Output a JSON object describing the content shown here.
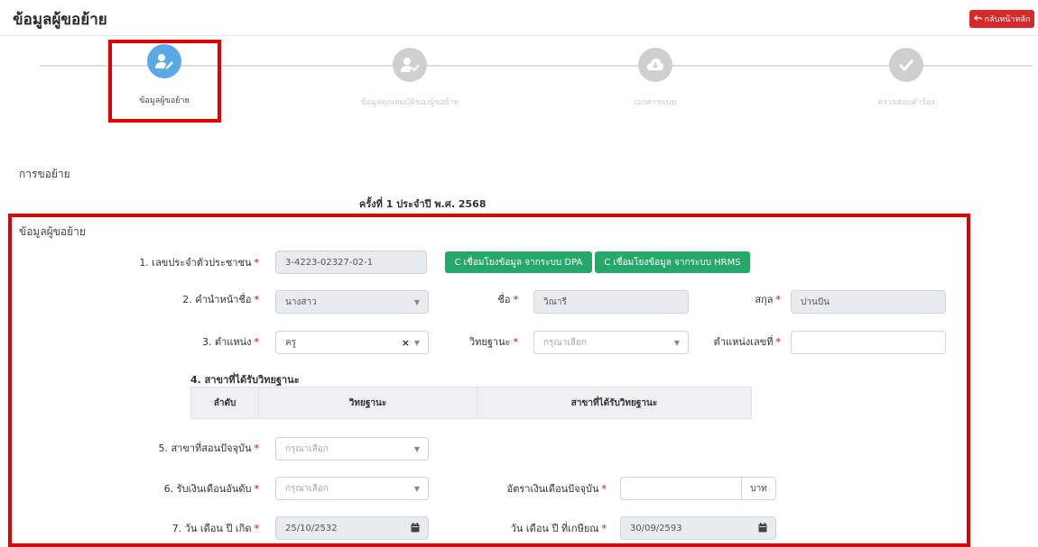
{
  "header": {
    "title": "ข้อมูลผู้ขอย้าย",
    "back_button": "กลับหน้าหลัก"
  },
  "wizard": {
    "steps": [
      {
        "label": "ข้อมูลผู้ขอย้าย",
        "state": "active",
        "icon": "user-edit-icon"
      },
      {
        "label": "ข้อมูลคุณสมบัติของผู้ขอย้าย",
        "state": "inactive",
        "icon": "user-check-icon"
      },
      {
        "label": "เอกสารแนบ",
        "state": "inactive",
        "icon": "cloud-download-icon"
      },
      {
        "label": "ตรวจสอบคำร้อง",
        "state": "inactive",
        "icon": "check-icon"
      }
    ]
  },
  "section": {
    "title": "การขอย้าย",
    "round": "ครั้งที่ 1 ประจำปี พ.ศ. 2568"
  },
  "form": {
    "title": "ข้อมูลผู้ขอย้าย",
    "required_mark": "*",
    "id_card": {
      "label": "1. เลขประจำตัวประชาชน",
      "value": "3-4223-02327-02-1"
    },
    "buttons": {
      "dpa": "เชื่อมโยงข้อมูล จากระบบ DPA",
      "hrms": "เชื่อมโยงข้อมูล จากระบบ HRMS"
    },
    "prefix": {
      "label": "2. คำนำหน้าชื่อ",
      "value": "นางสาว"
    },
    "first_name": {
      "label": "ชื่อ",
      "value": "วิณารี"
    },
    "last_name": {
      "label": "สกุล",
      "value": "ปานปัน"
    },
    "position": {
      "label": "3. ตำแหน่ง",
      "value": "ครู"
    },
    "academic_standing": {
      "label": "วิทยฐานะ",
      "placeholder": "กรุณาเลือก"
    },
    "position_number": {
      "label": "ตำแหน่งเลขที่",
      "value": ""
    },
    "standing_table": {
      "title": "4. สาขาที่ได้รับวิทยฐานะ",
      "columns": [
        "ลำดับ",
        "วิทยฐานะ",
        "สาขาที่ได้รับวิทยฐานะ"
      ]
    },
    "teaching_subject": {
      "label": "5. สาขาที่สอนปัจจุบัน",
      "placeholder": "กรุณาเลือก"
    },
    "salary_grade": {
      "label": "6. รับเงินเดือนอันดับ",
      "placeholder": "กรุณาเลือก"
    },
    "salary": {
      "label": "อัตราเงินเดือนปัจจุบัน",
      "value": "",
      "unit": "บาท"
    },
    "birth_date": {
      "label": "7. วัน เดือน ปี เกิด",
      "value": "25/10/2532"
    },
    "retire_date": {
      "label": "วัน เดือน ปี ที่เกษียณ",
      "value": "30/09/2593"
    }
  },
  "colors": {
    "accent": "#5aa9e6",
    "danger": "#d62a2a",
    "success": "#27a86b",
    "highlight": "#e00000"
  }
}
